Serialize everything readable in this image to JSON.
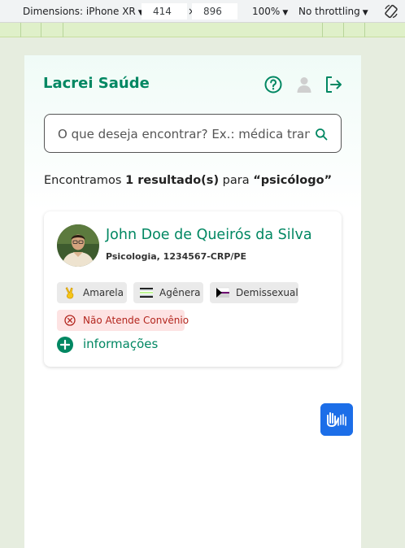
{
  "devtools": {
    "device": "Dimensions: iPhone XR",
    "width": "414",
    "times": "×",
    "height": "896",
    "zoom": "100%",
    "throttling": "No throttling"
  },
  "header": {
    "brand": "Lacrei Saúde",
    "icons": [
      "help-icon",
      "user-icon",
      "logout-icon"
    ]
  },
  "search": {
    "placeholder": "O que deseja encontrar? Ex.: médica trans ou nome"
  },
  "results": {
    "prefix": "Encontramos ",
    "count": "1 resultado(s)",
    "middle": " para ",
    "query": "“psicólogo”"
  },
  "card": {
    "name": "John Doe de Queirós da Silva",
    "specialty": "Psicologia, 1234567-CRP/PE",
    "tags": [
      {
        "label": "Amarela",
        "icon": "peace-hand-icon"
      },
      {
        "label": "Agênera",
        "icon": "agender-flag-icon"
      },
      {
        "label": "Demissexual",
        "icon": "demisexual-flag-icon"
      }
    ],
    "insurance": "Não Atende Convênio",
    "more": "informações"
  },
  "colors": {
    "brand": "#018762",
    "danger": "#b3261e",
    "accessibility": "#1c6ee8"
  }
}
